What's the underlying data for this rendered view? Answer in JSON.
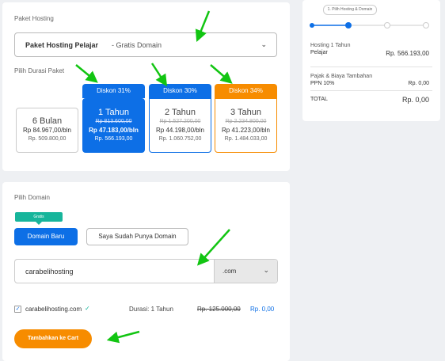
{
  "hosting": {
    "section_label": "Paket Hosting",
    "package_name": "Paket Hosting Pelajar",
    "package_suffix": " - Gratis Domain",
    "duration_label": "Pilih Durasi Paket",
    "durations": [
      {
        "title": "6 Bulan",
        "badge": "",
        "strike_price": "",
        "price_monthly": "Rp 84.967,00/bln",
        "price_total": "Rp. 509.800,00"
      },
      {
        "title": "1 Tahun",
        "badge": "Diskon 31%",
        "strike_price": "Rp 813.600,00",
        "price_monthly": "Rp 47.183,00/bln",
        "price_total": "Rp. 566.193,00"
      },
      {
        "title": "2 Tahun",
        "badge": "Diskon 30%",
        "strike_price": "Rp 1.527.200,00",
        "price_monthly": "Rp 44.198,00/bln",
        "price_total": "Rp. 1.060.752,00"
      },
      {
        "title": "3 Tahun",
        "badge": "Diskon 34%",
        "strike_price": "Rp 2.234.800,00",
        "price_monthly": "Rp 41.223,00/bln",
        "price_total": "Rp. 1.484.033,00"
      }
    ]
  },
  "summary": {
    "step_tooltip": "1. Pilih Hosting & Domain",
    "hosting_label": "Hosting 1 Tahun",
    "hosting_plan": "Pelajar",
    "hosting_price": "Rp. 566.193,00",
    "tax_title": "Pajak & Biaya Tambahan",
    "tax_label": "PPN 10%",
    "tax_value": "Rp. 0,00",
    "total_label": "TOTAL",
    "total_value": "Rp. 0,00"
  },
  "domain": {
    "section_label": "Pilih Domain",
    "free_badge": "Gratis",
    "new_domain_button": "Domain Baru",
    "own_domain_button": "Saya Sudah Punya Domain",
    "domain_input": "carabelihosting",
    "tld": ".com",
    "result_domain": "carabelihosting.com",
    "result_duration": "Durasi: 1 Tahun",
    "result_old_price": "Rp. 125.000,00",
    "result_price": "Rp. 0,00",
    "add_to_cart": "Tambahkan ke Cart"
  },
  "colors": {
    "blue": "#0d6fe6",
    "orange": "#f78c00",
    "green_arrow": "#12c512",
    "teal": "#17b59b"
  }
}
